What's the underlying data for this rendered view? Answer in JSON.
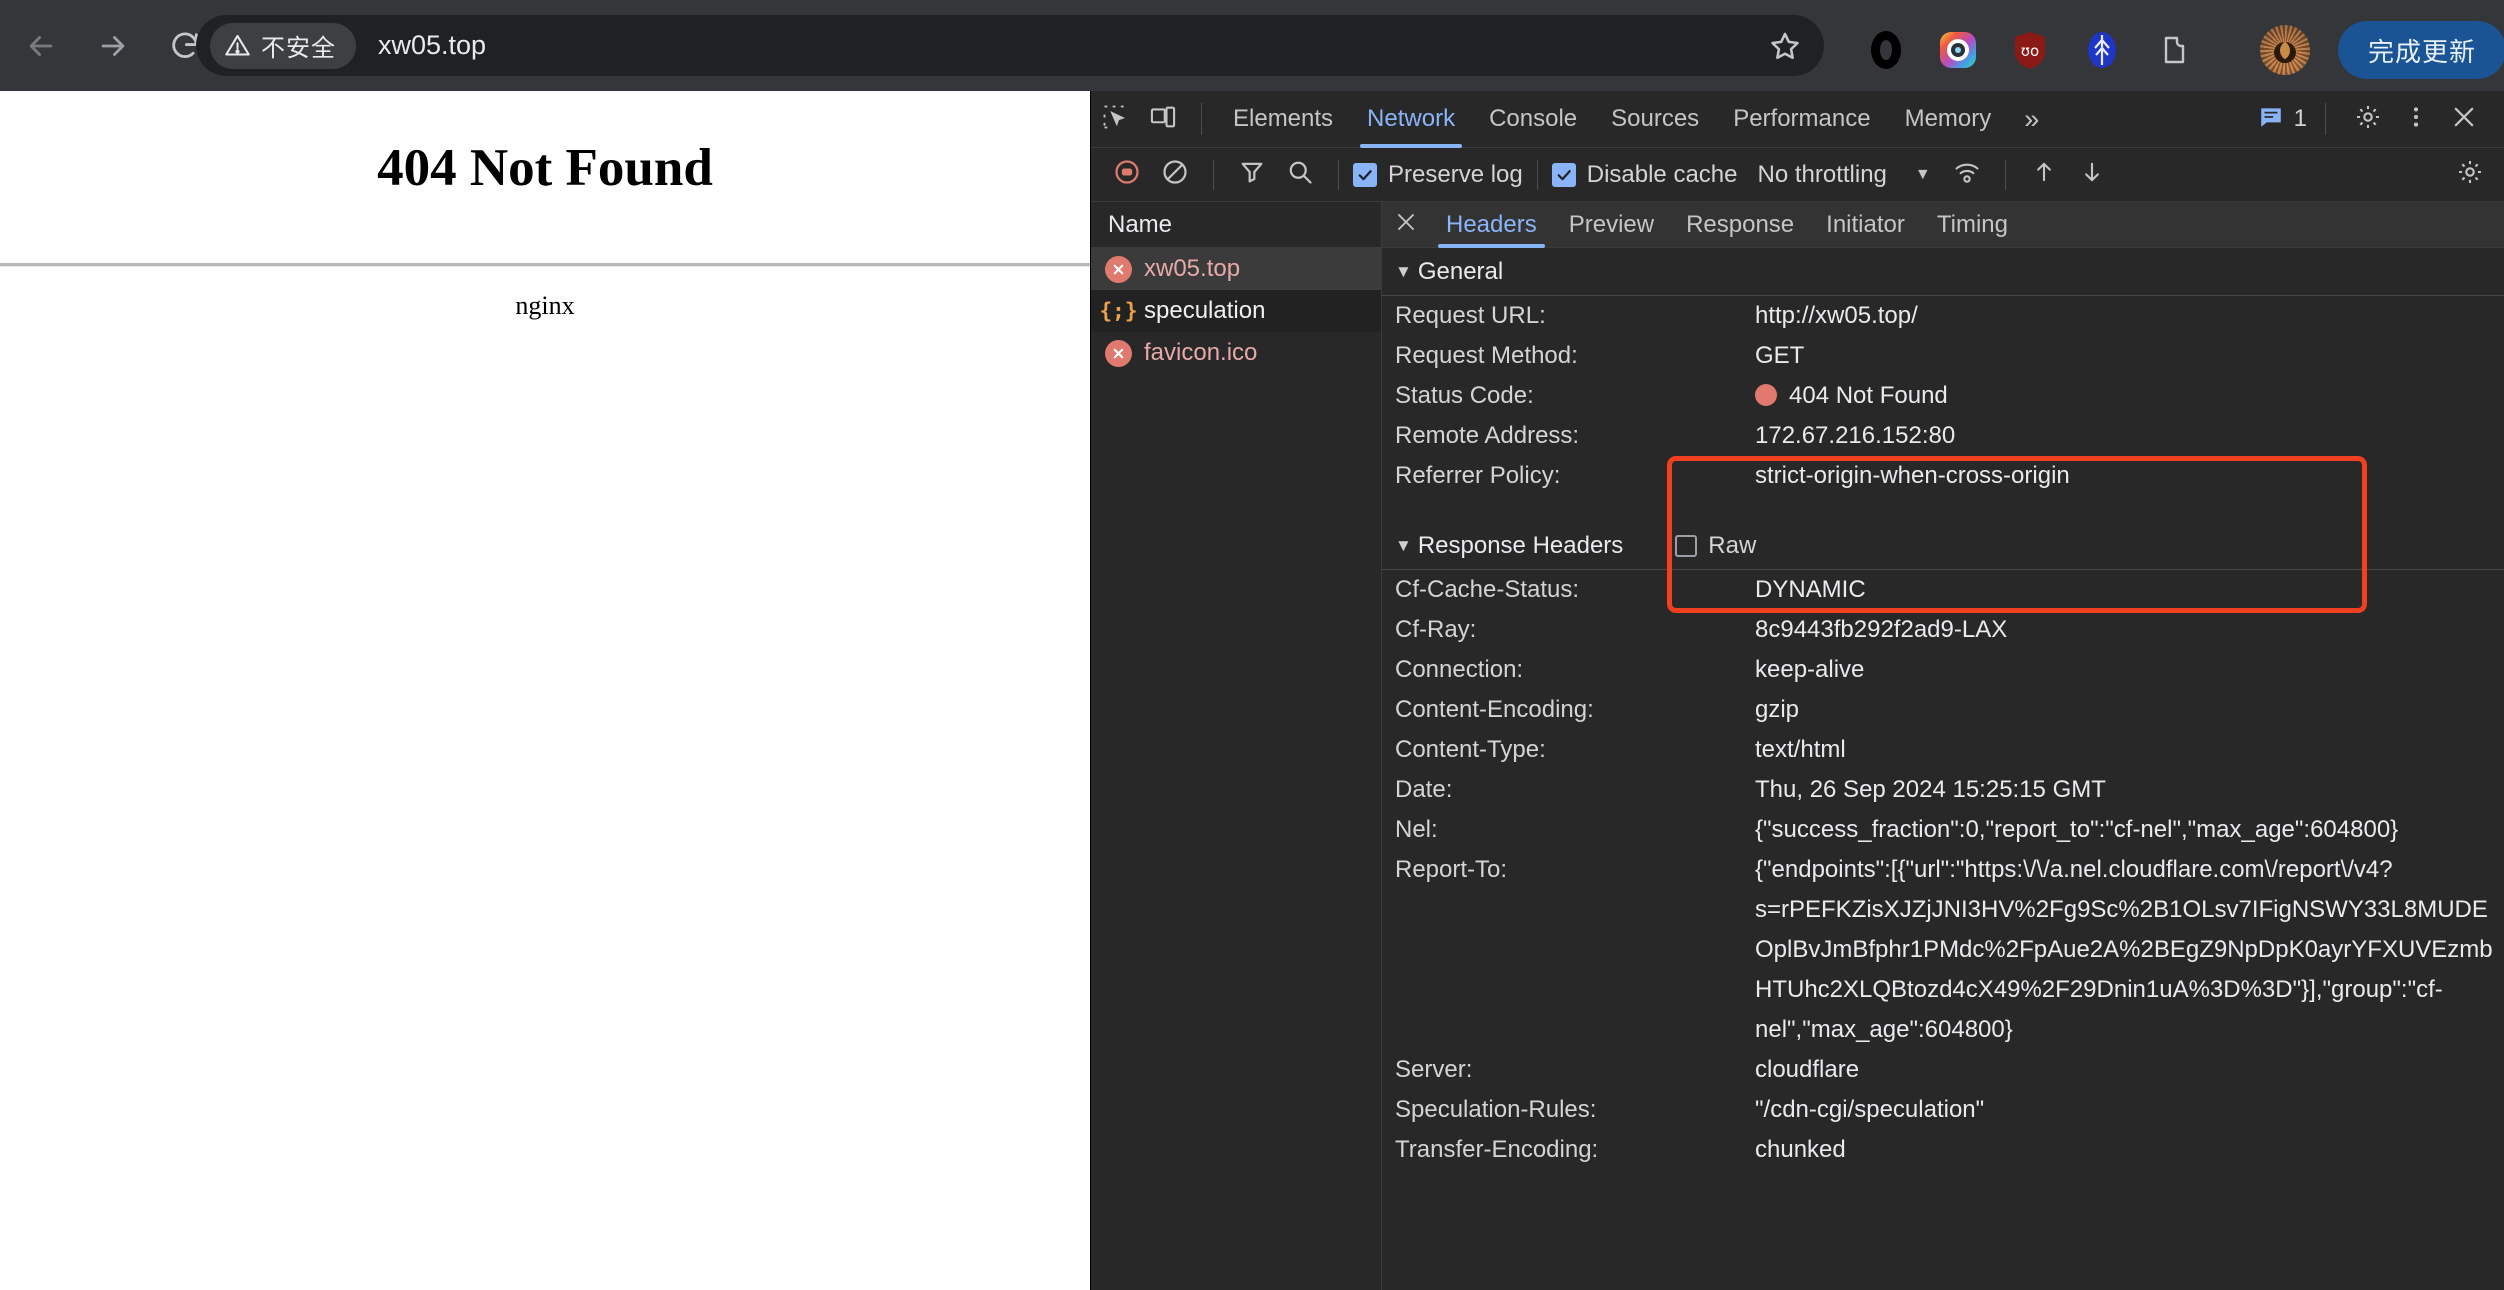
{
  "browser": {
    "back_icon": "back-arrow-icon",
    "forward_icon": "forward-arrow-icon",
    "reload_icon": "reload-icon",
    "security_chip_label": "不安全",
    "url": "xw05.top",
    "bookmark_icon": "star-icon",
    "update_button_label": "完成更新",
    "extensions": [
      {
        "name": "extension-ring-icon"
      },
      {
        "name": "extension-camera-icon"
      },
      {
        "name": "extension-ublock-icon"
      },
      {
        "name": "extension-shield-icon"
      },
      {
        "name": "extension-puzzle-icon"
      }
    ]
  },
  "page": {
    "heading": "404 Not Found",
    "server": "nginx"
  },
  "devtools": {
    "tabs": [
      {
        "label": "Elements",
        "active": false
      },
      {
        "label": "Network",
        "active": true
      },
      {
        "label": "Console",
        "active": false
      },
      {
        "label": "Sources",
        "active": false
      },
      {
        "label": "Performance",
        "active": false
      },
      {
        "label": "Memory",
        "active": false
      }
    ],
    "more_tabs_glyph": "»",
    "issue_count": "1",
    "network_toolbar": {
      "record_icon": "record-stop-icon",
      "clear_icon": "clear-icon",
      "filter_icon": "filter-icon",
      "search_icon": "search-icon",
      "preserve_log_label": "Preserve log",
      "preserve_log_checked": true,
      "disable_cache_label": "Disable cache",
      "disable_cache_checked": true,
      "throttling_value": "No throttling",
      "wifi_icon": "network-conditions-icon",
      "import_icon": "import-har-icon",
      "export_icon": "export-har-icon",
      "settings_icon": "gear-icon"
    },
    "request_list": {
      "column_header": "Name",
      "rows": [
        {
          "name": "xw05.top",
          "icon": "error-icon",
          "selected": true
        },
        {
          "name": "speculation",
          "icon": "json-icon",
          "selected": false
        },
        {
          "name": "favicon.ico",
          "icon": "error-icon",
          "selected": false
        }
      ]
    },
    "detail_tabs": [
      {
        "label": "Headers",
        "active": true
      },
      {
        "label": "Preview",
        "active": false
      },
      {
        "label": "Response",
        "active": false
      },
      {
        "label": "Initiator",
        "active": false
      },
      {
        "label": "Timing",
        "active": false
      }
    ],
    "general": {
      "section_title": "General",
      "rows": [
        {
          "key": "Request URL:",
          "value": "http://xw05.top/"
        },
        {
          "key": "Request Method:",
          "value": "GET"
        },
        {
          "key": "Status Code:",
          "value": "404 Not Found",
          "has_status_dot": true
        },
        {
          "key": "Remote Address:",
          "value": "172.67.216.152:80"
        },
        {
          "key": "Referrer Policy:",
          "value": "strict-origin-when-cross-origin"
        }
      ]
    },
    "response_headers": {
      "section_title": "Response Headers",
      "raw_label": "Raw",
      "raw_checked": false,
      "rows": [
        {
          "key": "Cf-Cache-Status:",
          "value": "DYNAMIC"
        },
        {
          "key": "Cf-Ray:",
          "value": "8c9443fb292f2ad9-LAX"
        },
        {
          "key": "Connection:",
          "value": "keep-alive"
        },
        {
          "key": "Content-Encoding:",
          "value": "gzip"
        },
        {
          "key": "Content-Type:",
          "value": "text/html"
        },
        {
          "key": "Date:",
          "value": "Thu, 26 Sep 2024 15:25:15 GMT"
        },
        {
          "key": "Nel:",
          "value": "{\"success_fraction\":0,\"report_to\":\"cf-nel\",\"max_age\":604800}"
        },
        {
          "key": "Report-To:",
          "value": "{\"endpoints\":[{\"url\":\"https:\\/\\/a.nel.cloudflare.com\\/report\\/v4?s=rPEFKZisXJZjJNI3HV%2Fg9Sc%2B1OLsv7IFigNSWY33L8MUDEOplBvJmBfphr1PMdc%2FpAue2A%2BEgZ9NpDpK0ayrYFXUVEzmbHTUhc2XLQBtozd4cX49%2F29Dnin1uA%3D%3D\"}],\"group\":\"cf-nel\",\"max_age\":604800}"
        },
        {
          "key": "Server:",
          "value": "cloudflare"
        },
        {
          "key": "Speculation-Rules:",
          "value": "\"/cdn-cgi/speculation\""
        },
        {
          "key": "Transfer-Encoding:",
          "value": "chunked"
        }
      ]
    },
    "highlight_color": "#f04020"
  }
}
